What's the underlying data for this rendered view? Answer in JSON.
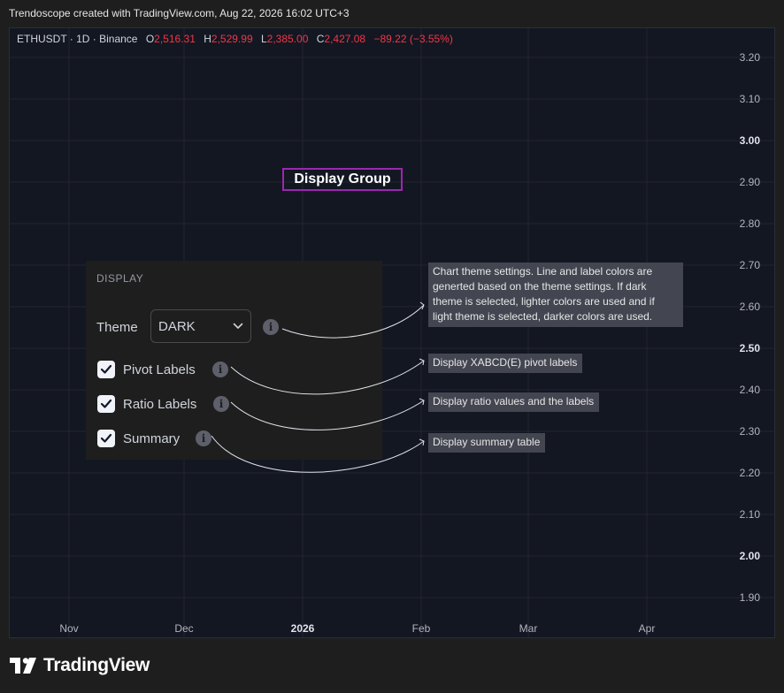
{
  "caption": "Trendoscope created with TradingView.com, Aug 22, 2026 16:02 UTC+3",
  "symbol": {
    "name": "ETHUSDT · 1D · Binance",
    "open_label": "O",
    "open": "2,516.31",
    "high_label": "H",
    "high": "2,529.99",
    "low_label": "L",
    "low": "2,385.00",
    "close_label": "C",
    "close": "2,427.08",
    "change": "−89.22 (−3.55%)"
  },
  "y_axis": [
    "3.20",
    "3.10",
    "3.00",
    "2.90",
    "2.80",
    "2.70",
    "2.60",
    "2.50",
    "2.40",
    "2.30",
    "2.20",
    "2.10",
    "2.00",
    "1.90"
  ],
  "y_axis_bold": [
    "3.00",
    "2.50",
    "2.00"
  ],
  "x_axis": [
    "Nov",
    "Dec",
    "2026",
    "Feb",
    "Mar",
    "Apr"
  ],
  "x_axis_bold": [
    "2026"
  ],
  "group_title": "Display Group",
  "panel": {
    "header": "DISPLAY",
    "theme_label": "Theme",
    "theme_value": "DARK",
    "options": [
      {
        "label": "Pivot Labels",
        "checked": true
      },
      {
        "label": "Ratio Labels",
        "checked": true
      },
      {
        "label": "Summary",
        "checked": true
      }
    ]
  },
  "callouts": {
    "theme": [
      "Chart theme settings. Line and label colors are",
      "generted based on the theme settings. If dark",
      "theme is selected, lighter colors are used and if",
      "light theme is selected, darker colors are used."
    ],
    "pivot": "Display XABCD(E) pivot labels",
    "ratio": "Display ratio values and the labels",
    "summary": "Display summary table"
  },
  "info_glyph": "i",
  "brand": "TradingView",
  "colors": {
    "background": "#1e1e1e",
    "chart_bg": "#131722",
    "accent_box": "#9c27b0",
    "down": "#f23645",
    "callout_bg": "#434651"
  },
  "icons": [
    "chevron-down-icon",
    "info-icon",
    "checkmark-icon",
    "tradingview-logo-icon"
  ]
}
